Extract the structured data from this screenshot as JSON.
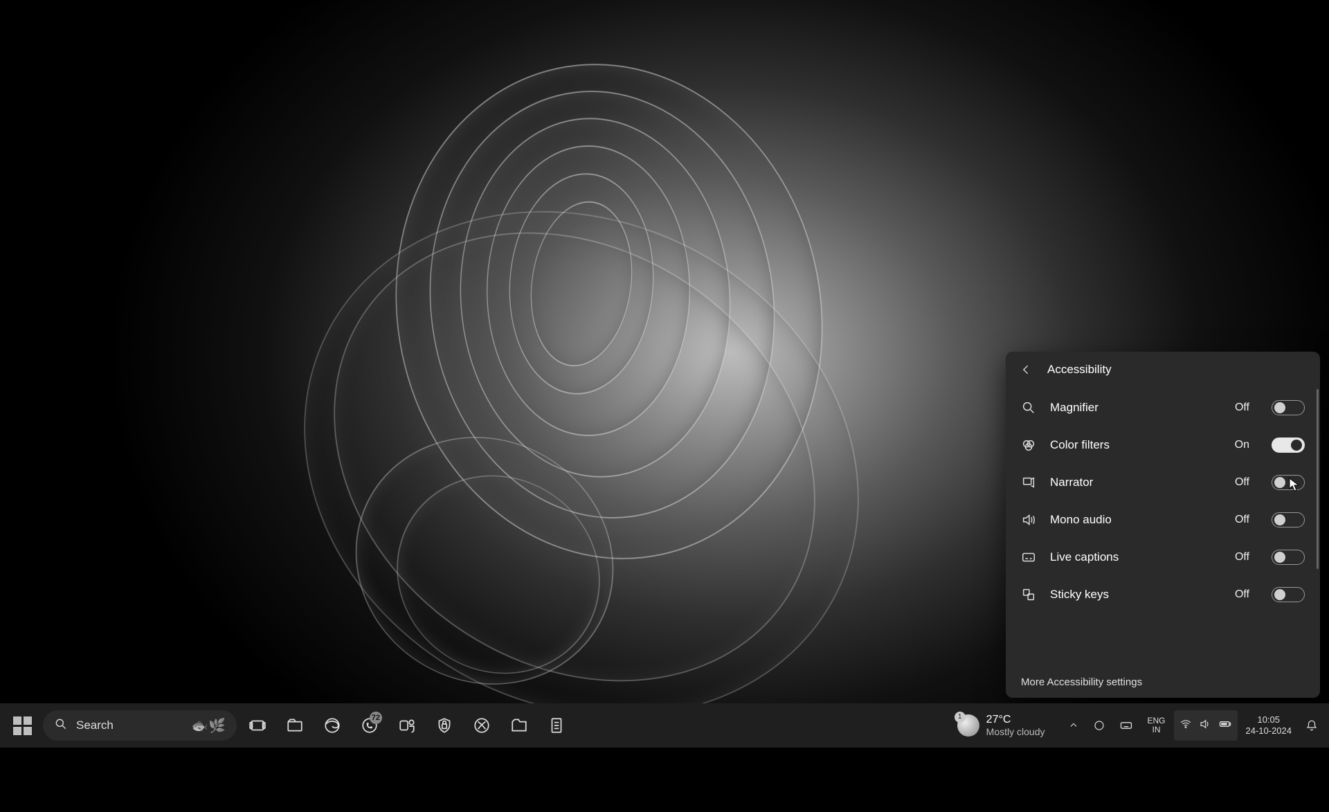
{
  "flyout": {
    "title": "Accessibility",
    "more_link": "More Accessibility settings",
    "items": [
      {
        "icon": "magnifier-icon",
        "label": "Magnifier",
        "state": "Off",
        "on": false
      },
      {
        "icon": "colorfilter-icon",
        "label": "Color filters",
        "state": "On",
        "on": true
      },
      {
        "icon": "narrator-icon",
        "label": "Narrator",
        "state": "Off",
        "on": false
      },
      {
        "icon": "monoaudio-icon",
        "label": "Mono audio",
        "state": "Off",
        "on": false
      },
      {
        "icon": "captions-icon",
        "label": "Live captions",
        "state": "Off",
        "on": false
      },
      {
        "icon": "stickykeys-icon",
        "label": "Sticky keys",
        "state": "Off",
        "on": false
      }
    ]
  },
  "search": {
    "placeholder": "Search"
  },
  "whatsapp_badge": "72",
  "weather": {
    "badge": "1",
    "temp": "27°C",
    "desc": "Mostly cloudy"
  },
  "lang": {
    "top": "ENG",
    "bottom": "IN"
  },
  "clock": {
    "time": "10:05",
    "date": "24-10-2024"
  }
}
